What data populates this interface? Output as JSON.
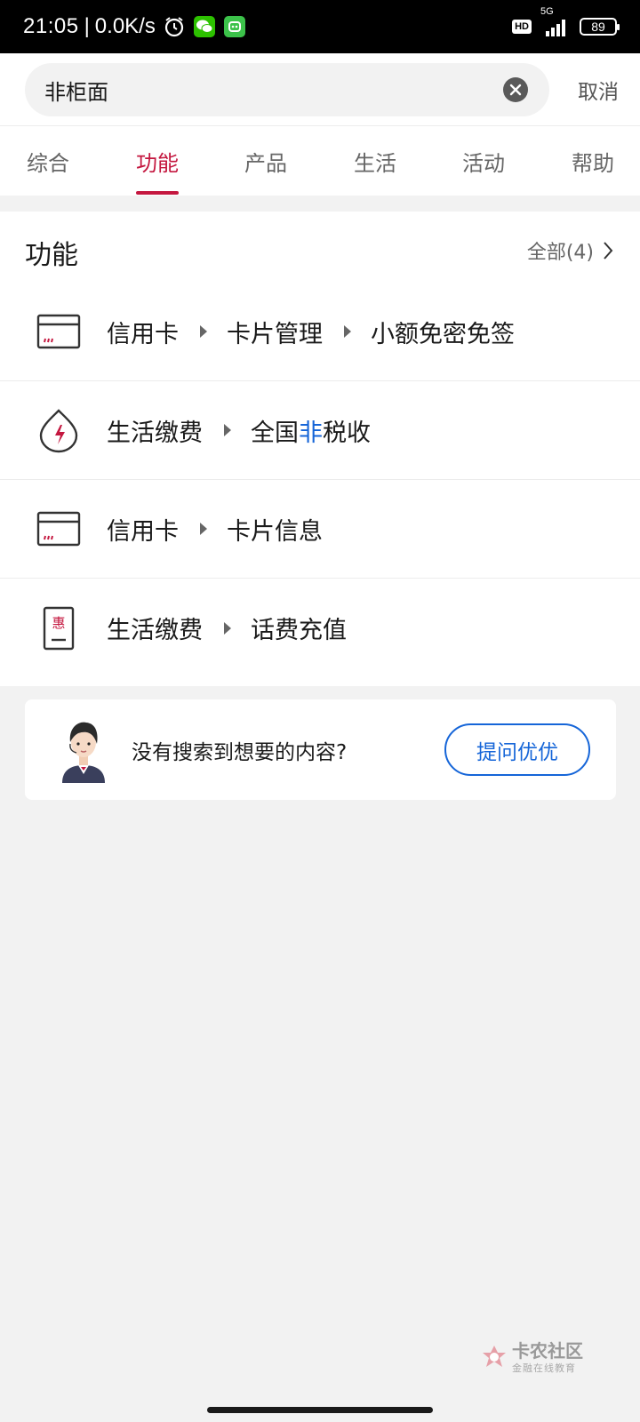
{
  "status_bar": {
    "time": "21:05",
    "separator": "|",
    "net_speed": "0.0K/s",
    "network": "5G",
    "hd_label": "HD",
    "battery": "89",
    "icons": [
      "alarm-icon",
      "wechat-icon",
      "app-notification-icon",
      "hd-badge",
      "signal-icon",
      "battery-icon"
    ]
  },
  "search": {
    "value": "非柜面",
    "cancel_label": "取消"
  },
  "tabs": [
    {
      "label": "综合",
      "active": false
    },
    {
      "label": "功能",
      "active": true
    },
    {
      "label": "产品",
      "active": false
    },
    {
      "label": "生活",
      "active": false
    },
    {
      "label": "活动",
      "active": false
    },
    {
      "label": "帮助",
      "active": false
    }
  ],
  "functions": {
    "title": "功能",
    "more_label": "全部(4)",
    "items": [
      {
        "icon": "credit-card-icon",
        "path": [
          "信用卡",
          "卡片管理",
          "小额免密免签"
        ]
      },
      {
        "icon": "utility-payment-icon",
        "path": [
          "生活缴费",
          "全国非税收"
        ],
        "highlight": "非"
      },
      {
        "icon": "credit-card-icon",
        "path": [
          "信用卡",
          "卡片信息"
        ]
      },
      {
        "icon": "phone-recharge-icon",
        "path": [
          "生活缴费",
          "话费充值"
        ]
      }
    ],
    "phone_icon_char": "惠"
  },
  "help": {
    "text": "没有搜索到想要的内容?",
    "button_label": "提问优优"
  },
  "watermark": {
    "title": "卡农社区",
    "subtitle": "金融在线教育"
  },
  "colors": {
    "accent_red": "#c4173f",
    "link_blue": "#1565d8",
    "background": "#f2f2f2"
  }
}
